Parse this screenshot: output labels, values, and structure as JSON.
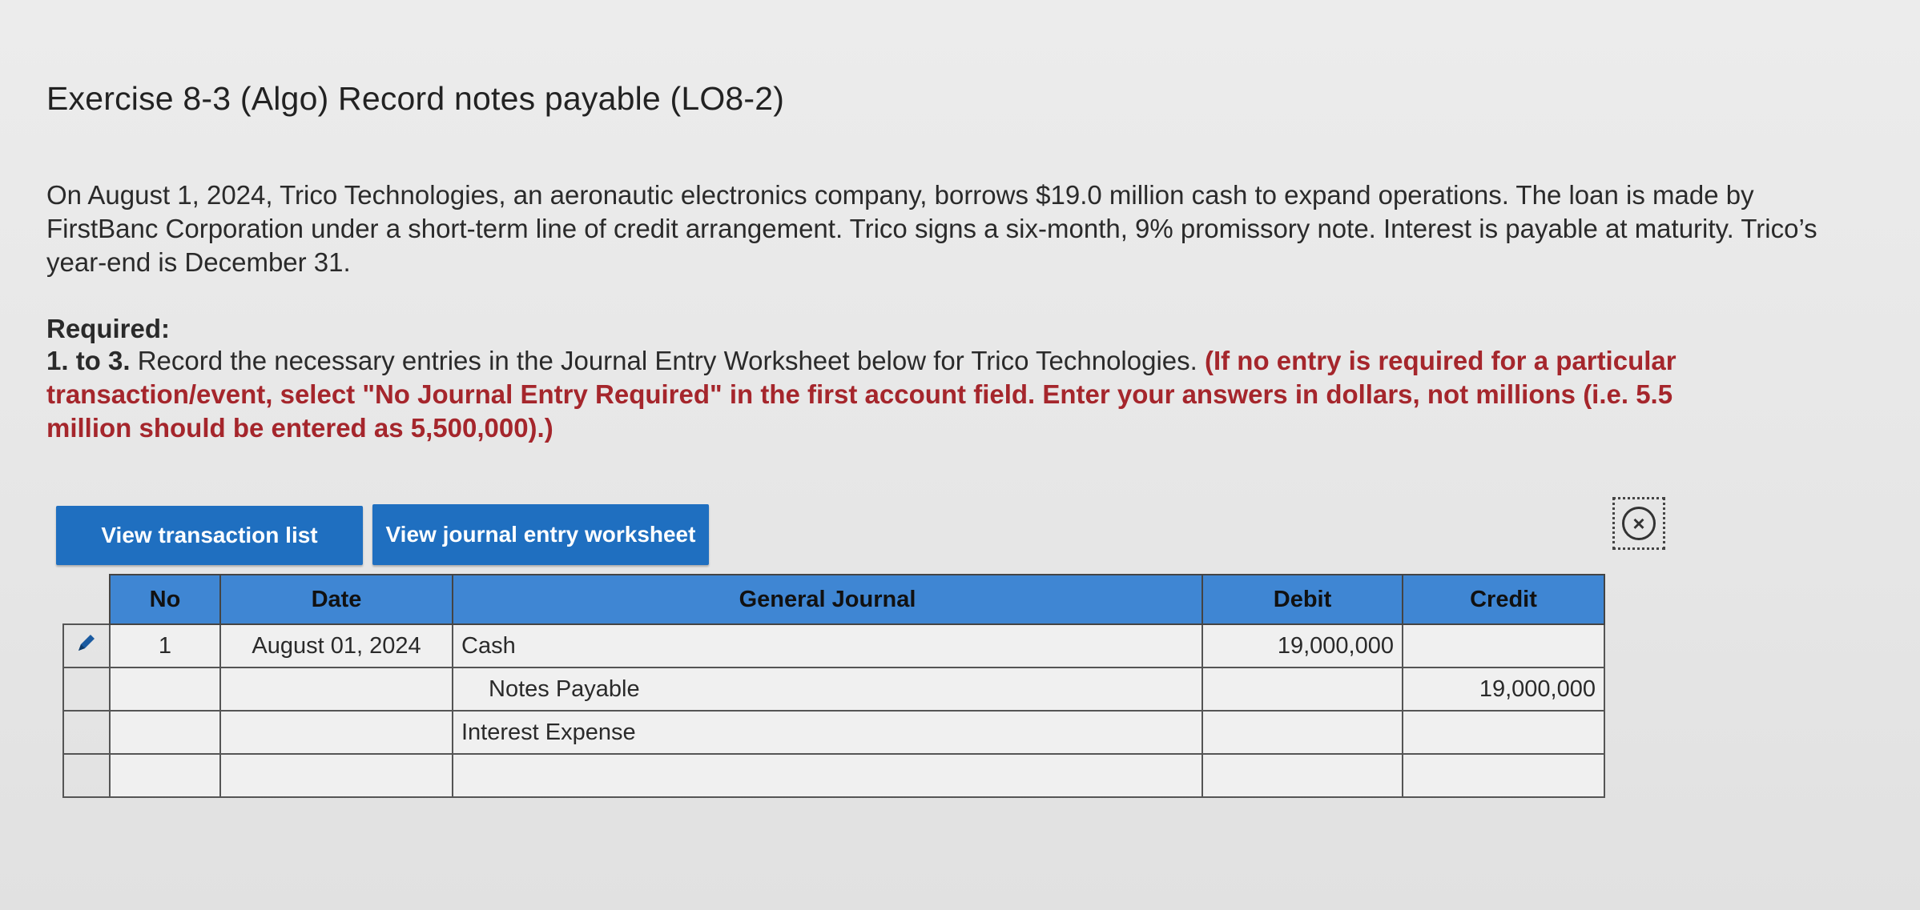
{
  "exercise": {
    "title": "Exercise 8-3 (Algo) Record notes payable (LO8-2)",
    "intro": "On August 1, 2024, Trico Technologies, an aeronautic electronics company, borrows $19.0 million cash to expand operations. The loan is made by FirstBanc Corporation under a short-term line of credit arrangement. Trico signs a six-month, 9% promissory note. Interest is payable at maturity. Trico’s year-end is December 31."
  },
  "required": {
    "heading": "Required:",
    "step_label": "1. to 3.",
    "instruction": " Record the necessary entries in the Journal Entry Worksheet below for Trico Technologies. ",
    "note": "(If no entry is required for a particular transaction/event, select \"No Journal Entry Required\" in the first account field. Enter your answers in dollars, not millions (i.e. 5.5 million should be entered as 5,500,000).)"
  },
  "buttons": {
    "view_transactions": "View transaction list",
    "view_worksheet": "View journal entry worksheet",
    "close_symbol": "×"
  },
  "journal": {
    "headers": {
      "no": "No",
      "date": "Date",
      "general_journal": "General Journal",
      "debit": "Debit",
      "credit": "Credit"
    },
    "rows": [
      {
        "no": "1",
        "date": "August 01, 2024",
        "account": "Cash",
        "debit": "19,000,000",
        "credit": ""
      },
      {
        "no": "",
        "date": "",
        "account": "Notes Payable",
        "debit": "",
        "credit": "19,000,000"
      },
      {
        "no": "",
        "date": "",
        "account": "Interest Expense",
        "debit": "",
        "credit": ""
      },
      {
        "no": "",
        "date": "",
        "account": "",
        "debit": "",
        "credit": ""
      }
    ]
  },
  "colors": {
    "button_blue": "#1f6fc0",
    "header_blue": "#3f86d3",
    "instruction_red": "#a5262c"
  },
  "icons": {
    "edit": "pencil-icon",
    "close": "close-circle-icon"
  }
}
